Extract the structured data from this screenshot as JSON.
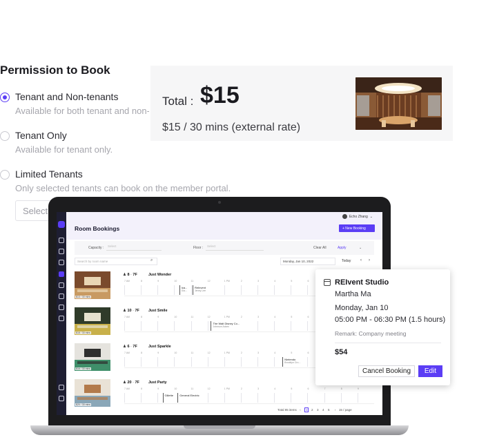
{
  "permission": {
    "title": "Permission to Book",
    "options": [
      {
        "label": "Tenant and Non-tenants",
        "desc": "Available for both tenant and non-",
        "selected": true
      },
      {
        "label": "Tenant Only",
        "desc": "Available for tenant only.",
        "selected": false
      },
      {
        "label": "Limited Tenants",
        "desc": "Only selected tenants can book on the member portal.",
        "selected": false
      }
    ],
    "select_placeholder": "Select"
  },
  "price_card": {
    "total_label": "Total :",
    "total_value": "$15",
    "rate": "$15 / 30 mins (external rate)"
  },
  "app": {
    "user": "Echo Zhang",
    "title": "Room Bookings",
    "new_booking": "+ New Booking",
    "filters": {
      "capacity_label": "Capacity :",
      "capacity_placeholder": "Select",
      "floor_label": "Floor :",
      "floor_placeholder": "Select",
      "clear_all": "Clear All",
      "apply": "Apply"
    },
    "search_placeholder": "Search by room name",
    "date": "Monday, Jan 10, 2022",
    "today": "Today",
    "hours": [
      "7 AM",
      "8",
      "9",
      "10",
      "11",
      "12",
      "1 PM",
      "2",
      "3",
      "4",
      "5",
      "6",
      "7",
      "8",
      "9"
    ],
    "rooms": [
      {
        "capacity": "8",
        "floor": "7F",
        "name": "Just Wonder",
        "price": "$13 / 30 mins",
        "bookings": [
          {
            "title": "Ica...",
            "sub": "Gia...",
            "selected": false
          },
          {
            "title": "ReInvent",
            "sub": "Jenny Lee",
            "selected": false
          }
        ]
      },
      {
        "capacity": "10",
        "floor": "7F",
        "name": "Just Smile",
        "price": "$18 / 30 mins",
        "bookings": [
          {
            "title": "The Walt Disney Co...",
            "sub": "Johnson Adam",
            "selected": false
          },
          {
            "title": "REInvent",
            "sub": "Martha Ma",
            "selected": true
          }
        ]
      },
      {
        "capacity": "6",
        "floor": "7F",
        "name": "Just Sparkle",
        "price": "$16 / 30 mins",
        "bookings": [
          {
            "title": "Nintendo",
            "sub": "Brooklyn Cro...",
            "selected": false
          }
        ]
      },
      {
        "capacity": "20",
        "floor": "7F",
        "name": "Just Party",
        "price": "$20 / 30 mins",
        "bookings": [
          {
            "title": "Gillette",
            "sub": "",
            "selected": false
          },
          {
            "title": "General Electric",
            "sub": "",
            "selected": false
          }
        ]
      }
    ],
    "pager": {
      "total": "Total 85 items",
      "pages": [
        "1",
        "2",
        "3",
        "4",
        "5"
      ],
      "current": "1",
      "page_size": "15 / page"
    }
  },
  "popup": {
    "room": "REIvent Studio",
    "person": "Martha Ma",
    "date": "Monday, Jan 10",
    "time": "05:00 PM - 06:30 PM (1.5 hours)",
    "remark": "Remark: Company meeting",
    "price": "$54",
    "cancel": "Cancel Booking",
    "edit": "Edit"
  },
  "colors": {
    "accent": "#5b3df5",
    "sidebar": "#1e1e32",
    "laptop_frame": "#1c1c1e"
  }
}
